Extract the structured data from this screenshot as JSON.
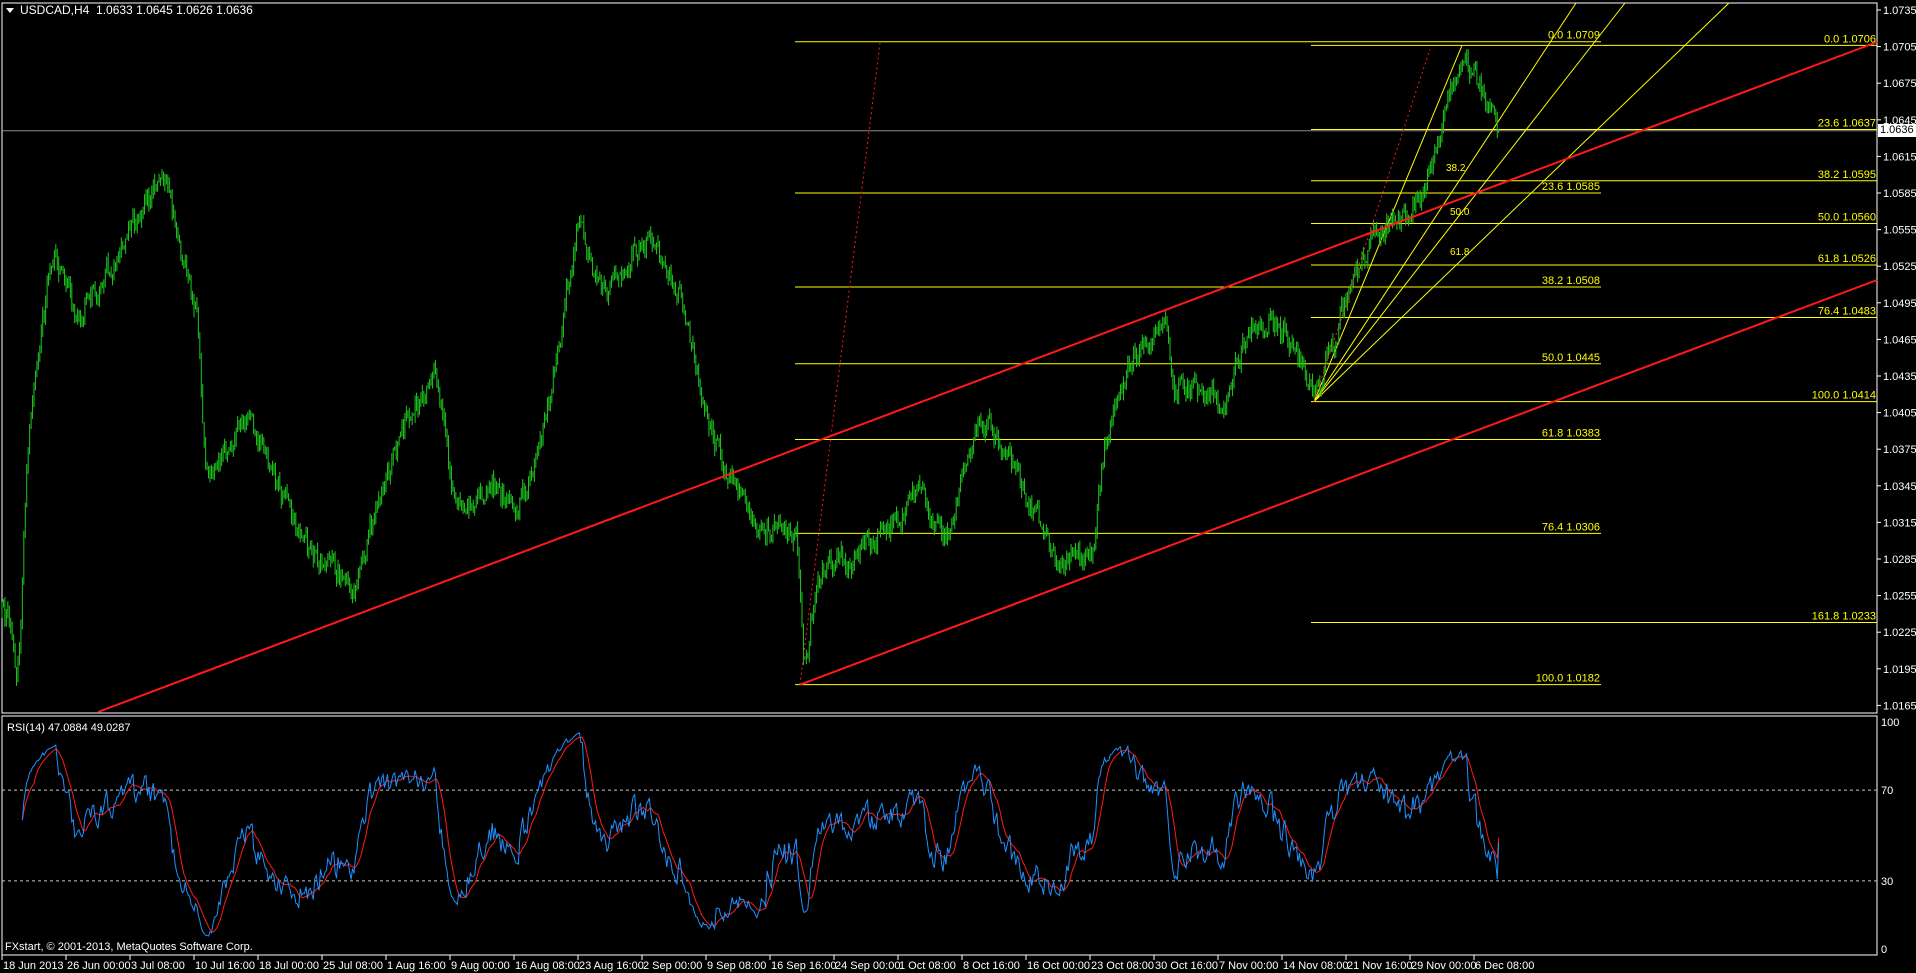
{
  "header": {
    "symbol": "USDCAD,H4",
    "quote": "1.0633 1.0645 1.0626 1.0636"
  },
  "current_price": "1.0636",
  "rsi_panel": {
    "label": "RSI(14) 47.0884 49.0287",
    "axis": [
      "100",
      "70",
      "30",
      "0"
    ],
    "levels": [
      70,
      30
    ]
  },
  "copyright": "FXstart, © 2001-2013, MetaQuotes Software Corp.",
  "colors": {
    "candle": "#1ec81e",
    "trend": "#ff1a1a",
    "fibo": "#ffff00",
    "rsi": "#1e90ff",
    "rsi_signal": "#ff1a1a"
  },
  "chart_data": {
    "type": "candlestick",
    "symbol": "USDCAD",
    "timeframe": "H4",
    "y_axis_ticks": [
      "1.0735",
      "1.0705",
      "1.0675",
      "1.0645",
      "1.0615",
      "1.0585",
      "1.0555",
      "1.0525",
      "1.0495",
      "1.0465",
      "1.0435",
      "1.0405",
      "1.0375",
      "1.0345",
      "1.0315",
      "1.0285",
      "1.0255",
      "1.0225",
      "1.0195",
      "1.0165"
    ],
    "ylim": [
      1.016,
      1.074
    ],
    "x_axis_ticks": [
      "18 Jun 2013",
      "26 Jun 00:00",
      "3 Jul 08:00",
      "10 Jul 16:00",
      "18 Jul 00:00",
      "25 Jul 08:00",
      "1 Aug 16:00",
      "9 Aug 00:00",
      "16 Aug 08:00",
      "23 Aug 16:00",
      "2 Sep 00:00",
      "9 Sep 08:00",
      "16 Sep 16:00",
      "24 Sep 00:00",
      "1 Oct 08:00",
      "8 Oct 16:00",
      "16 Oct 00:00",
      "23 Oct 08:00",
      "30 Oct 16:00",
      "7 Nov 00:00",
      "14 Nov 08:00",
      "21 Nov 16:00",
      "29 Nov 00:00",
      "6 Dec 08:00"
    ],
    "bars_per_tick": 44,
    "price_path_anchors": [
      [
        0,
        1.024
      ],
      [
        4,
        1.0233
      ],
      [
        10,
        1.018
      ],
      [
        17,
        1.0392
      ],
      [
        34,
        1.0543
      ],
      [
        50,
        1.048
      ],
      [
        84,
        1.0543
      ],
      [
        109,
        1.0603
      ],
      [
        134,
        1.048
      ],
      [
        139,
        1.0342
      ],
      [
        168,
        1.04
      ],
      [
        210,
        1.029
      ],
      [
        244,
        1.0262
      ],
      [
        252,
        1.031
      ],
      [
        277,
        1.04
      ],
      [
        298,
        1.0442
      ],
      [
        311,
        1.032
      ],
      [
        336,
        1.035
      ],
      [
        353,
        1.032
      ],
      [
        370,
        1.038
      ],
      [
        395,
        1.0563
      ],
      [
        412,
        1.05
      ],
      [
        445,
        1.055
      ],
      [
        466,
        1.05
      ],
      [
        483,
        1.04
      ],
      [
        496,
        1.036
      ],
      [
        512,
        1.032
      ],
      [
        546,
        1.0302
      ],
      [
        551,
        1.0185
      ],
      [
        559,
        1.0275
      ],
      [
        588,
        1.029
      ],
      [
        630,
        1.0337
      ],
      [
        647,
        1.03
      ],
      [
        672,
        1.0403
      ],
      [
        697,
        1.0355
      ],
      [
        722,
        1.029
      ],
      [
        748,
        1.0283
      ],
      [
        756,
        1.038
      ],
      [
        773,
        1.0442
      ],
      [
        798,
        1.0483
      ],
      [
        806,
        1.0425
      ],
      [
        840,
        1.0415
      ],
      [
        857,
        1.048
      ],
      [
        882,
        1.047
      ],
      [
        903,
        1.0418
      ],
      [
        924,
        1.05
      ],
      [
        941,
        1.055
      ],
      [
        966,
        1.0565
      ],
      [
        983,
        1.0605
      ],
      [
        991,
        1.065
      ],
      [
        1004,
        1.0703
      ],
      [
        1016,
        1.0665
      ],
      [
        1029,
        1.0636
      ]
    ],
    "fibo_retracement_1": {
      "levels": [
        [
          "0.0",
          "1.0709"
        ],
        [
          "23.6",
          "1.0585"
        ],
        [
          "38.2",
          "1.0508"
        ],
        [
          "50.0",
          "1.0445"
        ],
        [
          "61.8",
          "1.0383"
        ],
        [
          "76.4",
          "1.0306"
        ],
        [
          "100.0",
          "1.0182"
        ]
      ]
    },
    "fibo_retracement_2": {
      "levels": [
        [
          "0.0",
          "1.0706"
        ],
        [
          "23.6",
          "1.0637"
        ],
        [
          "38.2",
          "1.0595"
        ],
        [
          "50.0",
          "1.0560"
        ],
        [
          "61.8",
          "1.0526"
        ],
        [
          "76.4",
          "1.0483"
        ],
        [
          "100.0",
          "1.0414"
        ],
        [
          "161.8",
          "1.0233"
        ]
      ]
    },
    "fibo_fan": {
      "labels": [
        "38.2",
        "50.0",
        "61.8"
      ]
    },
    "rsi": {
      "period": 14,
      "value": 47.0884,
      "signal": 49.0287,
      "ylim": [
        0,
        100
      ]
    }
  }
}
